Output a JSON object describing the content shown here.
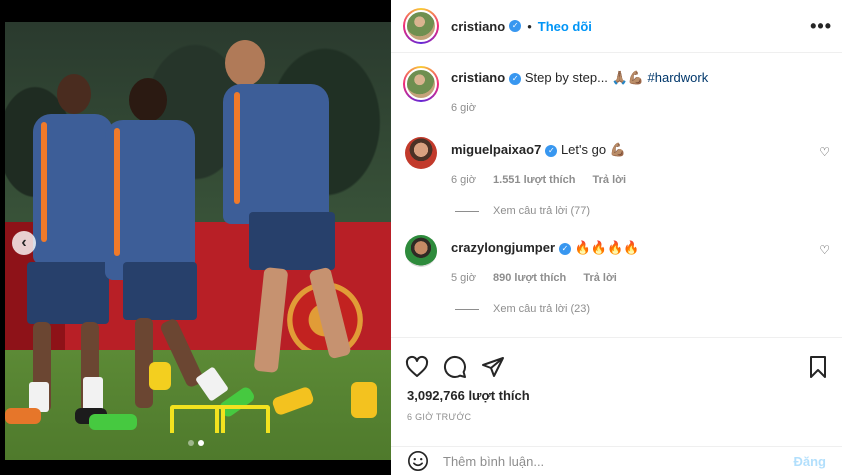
{
  "post": {
    "username": "cristiano",
    "follow_label": "Theo dõi",
    "separator": "•",
    "more_label": "•••"
  },
  "caption": {
    "username": "cristiano",
    "text": "Step by step... 🙏🏽💪🏽",
    "hashtag": "#hardwork",
    "time": "6 giờ"
  },
  "comments": [
    {
      "username": "miguelpaixao7",
      "text": "Let's go 💪🏽",
      "time": "6 giờ",
      "likes": "1.551 lượt thích",
      "reply": "Trả lời",
      "view_replies": "Xem câu trả lời (77)"
    },
    {
      "username": "crazylongjumper",
      "text": "🔥🔥🔥🔥",
      "time": "5 giờ",
      "likes": "890 lượt thích",
      "reply": "Trả lời",
      "view_replies": "Xem câu trả lời (23)"
    }
  ],
  "actions": {
    "likes_count": "3,092,766 lượt thích",
    "date": "6 GIỜ TRƯỚC"
  },
  "add_comment": {
    "placeholder": "Thêm bình luận...",
    "post_label": "Đăng"
  },
  "carousel": {
    "prev_label": "‹",
    "slide_count": 2,
    "active_index": 1
  },
  "colors": {
    "accent": "#0095f6",
    "verified": "#3897f0",
    "post_disabled": "#b2dffc"
  },
  "icons": [
    "verified-badge-icon",
    "more-options-icon",
    "heart-icon",
    "comment-icon",
    "share-icon",
    "bookmark-icon",
    "emoji-icon",
    "chevron-left-icon"
  ]
}
